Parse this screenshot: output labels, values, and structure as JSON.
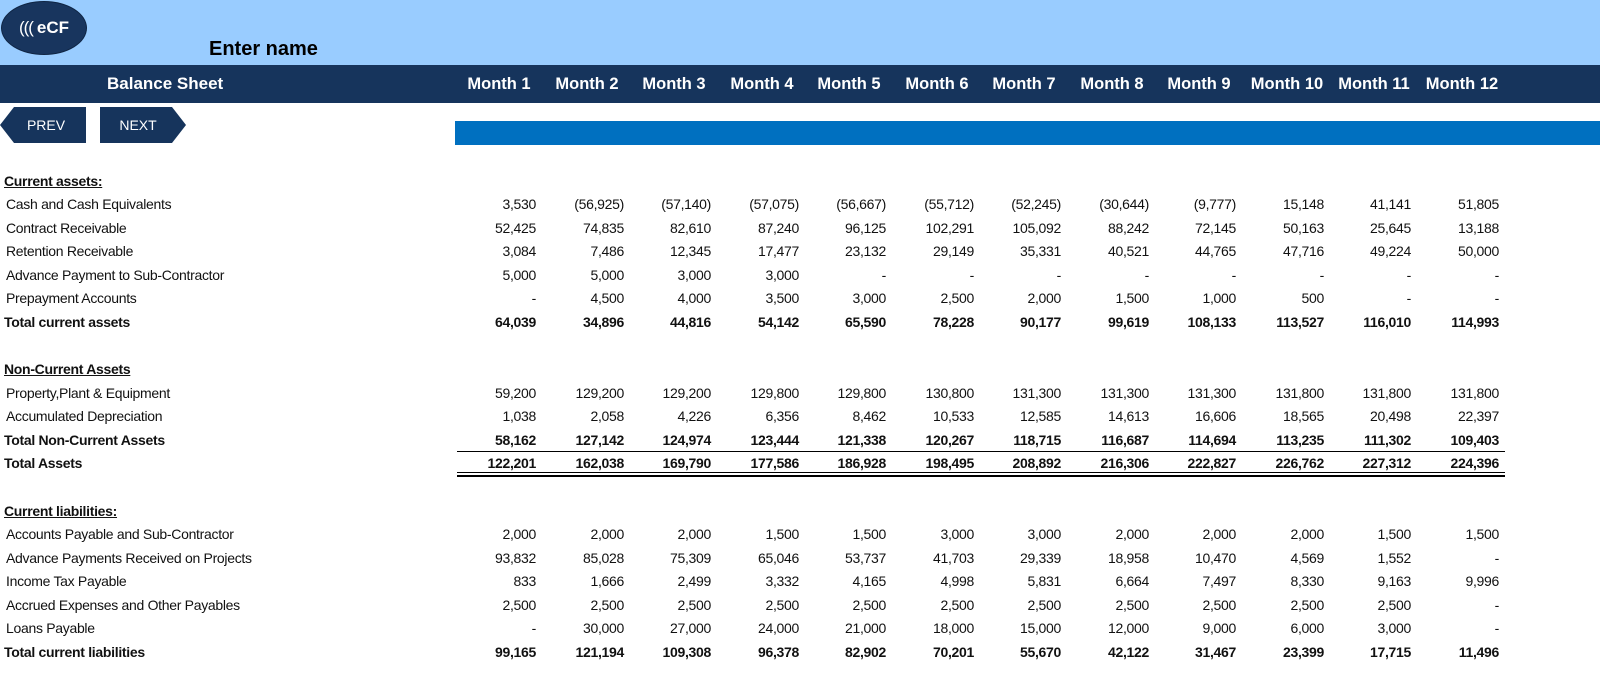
{
  "logo": {
    "waves": "(((",
    "text": "eCF"
  },
  "enter_name": "Enter name",
  "header": {
    "title": "Balance Sheet",
    "months": [
      "Month 1",
      "Month 2",
      "Month 3",
      "Month 4",
      "Month 5",
      "Month 6",
      "Month 7",
      "Month 8",
      "Month 9",
      "Month 10",
      "Month 11",
      "Month 12"
    ]
  },
  "nav": {
    "prev": "PREV",
    "next": "NEXT"
  },
  "colors": {
    "top_bar": "#99ccff",
    "header_bar": "#16345c",
    "accent_bar": "#0070c0"
  },
  "rows": [
    {
      "type": "section",
      "label": "Current assets:"
    },
    {
      "type": "item",
      "label": "Cash and Cash Equivalents",
      "values": [
        "3,530",
        "(56,925)",
        "(57,140)",
        "(57,075)",
        "(56,667)",
        "(55,712)",
        "(52,245)",
        "(30,644)",
        "(9,777)",
        "15,148",
        "41,141",
        "51,805"
      ]
    },
    {
      "type": "item",
      "label": "Contract Receivable",
      "values": [
        "52,425",
        "74,835",
        "82,610",
        "87,240",
        "96,125",
        "102,291",
        "105,092",
        "88,242",
        "72,145",
        "50,163",
        "25,645",
        "13,188"
      ]
    },
    {
      "type": "item",
      "label": "Retention Receivable",
      "values": [
        "3,084",
        "7,486",
        "12,345",
        "17,477",
        "23,132",
        "29,149",
        "35,331",
        "40,521",
        "44,765",
        "47,716",
        "49,224",
        "50,000"
      ]
    },
    {
      "type": "item",
      "label": "Advance Payment to Sub-Contractor",
      "values": [
        "5,000",
        "5,000",
        "3,000",
        "3,000",
        "-",
        "-",
        "-",
        "-",
        "-",
        "-",
        "-",
        "-"
      ]
    },
    {
      "type": "item",
      "label": "Prepayment Accounts",
      "values": [
        "-",
        "4,500",
        "4,000",
        "3,500",
        "3,000",
        "2,500",
        "2,000",
        "1,500",
        "1,000",
        "500",
        "-",
        "-"
      ]
    },
    {
      "type": "total",
      "label": "Total current assets",
      "values": [
        "64,039",
        "34,896",
        "44,816",
        "54,142",
        "65,590",
        "78,228",
        "90,177",
        "99,619",
        "108,133",
        "113,527",
        "116,010",
        "114,993"
      ]
    },
    {
      "type": "section",
      "label": "Non-Current Assets"
    },
    {
      "type": "item",
      "label": "Property,Plant & Equipment",
      "values": [
        "59,200",
        "129,200",
        "129,200",
        "129,800",
        "129,800",
        "130,800",
        "131,300",
        "131,300",
        "131,300",
        "131,800",
        "131,800",
        "131,800"
      ]
    },
    {
      "type": "item",
      "label": "Accumulated Depreciation",
      "values": [
        "1,038",
        "2,058",
        "4,226",
        "6,356",
        "8,462",
        "10,533",
        "12,585",
        "14,613",
        "16,606",
        "18,565",
        "20,498",
        "22,397"
      ]
    },
    {
      "type": "total",
      "label": "Total Non-Current Assets",
      "values": [
        "58,162",
        "127,142",
        "124,974",
        "123,444",
        "121,338",
        "120,267",
        "118,715",
        "116,687",
        "114,694",
        "113,235",
        "111,302",
        "109,403"
      ]
    },
    {
      "type": "total",
      "label": "Total Assets",
      "values": [
        "122,201",
        "162,038",
        "169,790",
        "177,586",
        "186,928",
        "198,495",
        "208,892",
        "216,306",
        "222,827",
        "226,762",
        "227,312",
        "224,396"
      ]
    },
    {
      "type": "section",
      "label": "Current liabilities:"
    },
    {
      "type": "item",
      "label": "Accounts Payable and Sub-Contractor",
      "values": [
        "2,000",
        "2,000",
        "2,000",
        "1,500",
        "1,500",
        "3,000",
        "3,000",
        "2,000",
        "2,000",
        "2,000",
        "1,500",
        "1,500"
      ]
    },
    {
      "type": "item",
      "label": "Advance Payments Received on Projects",
      "values": [
        "93,832",
        "85,028",
        "75,309",
        "65,046",
        "53,737",
        "41,703",
        "29,339",
        "18,958",
        "10,470",
        "4,569",
        "1,552",
        "-"
      ]
    },
    {
      "type": "item",
      "label": "Income Tax Payable",
      "values": [
        "833",
        "1,666",
        "2,499",
        "3,332",
        "4,165",
        "4,998",
        "5,831",
        "6,664",
        "7,497",
        "8,330",
        "9,163",
        "9,996"
      ]
    },
    {
      "type": "item",
      "label": "Accrued Expenses and Other Payables",
      "values": [
        "2,500",
        "2,500",
        "2,500",
        "2,500",
        "2,500",
        "2,500",
        "2,500",
        "2,500",
        "2,500",
        "2,500",
        "2,500",
        "-"
      ]
    },
    {
      "type": "item",
      "label": "Loans Payable",
      "values": [
        "-",
        "30,000",
        "27,000",
        "24,000",
        "21,000",
        "18,000",
        "15,000",
        "12,000",
        "9,000",
        "6,000",
        "3,000",
        "-"
      ]
    },
    {
      "type": "total",
      "label": "Total current liabilities",
      "values": [
        "99,165",
        "121,194",
        "109,308",
        "96,378",
        "82,902",
        "70,201",
        "55,670",
        "42,122",
        "31,467",
        "23,399",
        "17,715",
        "11,496"
      ]
    }
  ]
}
